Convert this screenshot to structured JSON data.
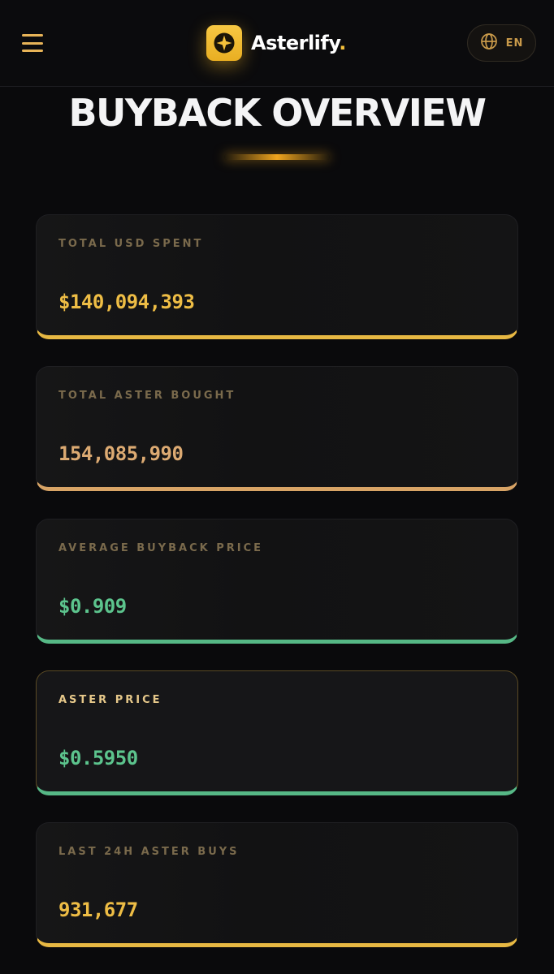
{
  "header": {
    "brand_name": "Asterlify",
    "brand_dot": ".",
    "language": "EN",
    "menu_icon": "hamburger-menu-icon",
    "language_icon": "globe-icon",
    "logo_icon": "four-point-star-icon"
  },
  "page": {
    "title": "BUYBACK OVERVIEW"
  },
  "cards": [
    {
      "label": "TOTAL USD SPENT",
      "value": "$140,094,393",
      "value_color": "#eebd45",
      "accent": "#e7b843"
    },
    {
      "label": "TOTAL ASTER BOUGHT",
      "value": "154,085,990",
      "value_color": "#dcaa72",
      "accent": "#d8a466"
    },
    {
      "label": "AVERAGE BUYBACK PRICE",
      "value": "$0.909",
      "value_color": "#5cc48d",
      "accent": "#56b886"
    },
    {
      "label": "ASTER PRICE",
      "value": "$0.5950",
      "value_color": "#5cc48d",
      "accent": "#56b886"
    },
    {
      "label": "LAST 24H ASTER BUYS",
      "value": "931,677",
      "value_color": "#eebd45",
      "accent": "#e7b843"
    }
  ]
}
